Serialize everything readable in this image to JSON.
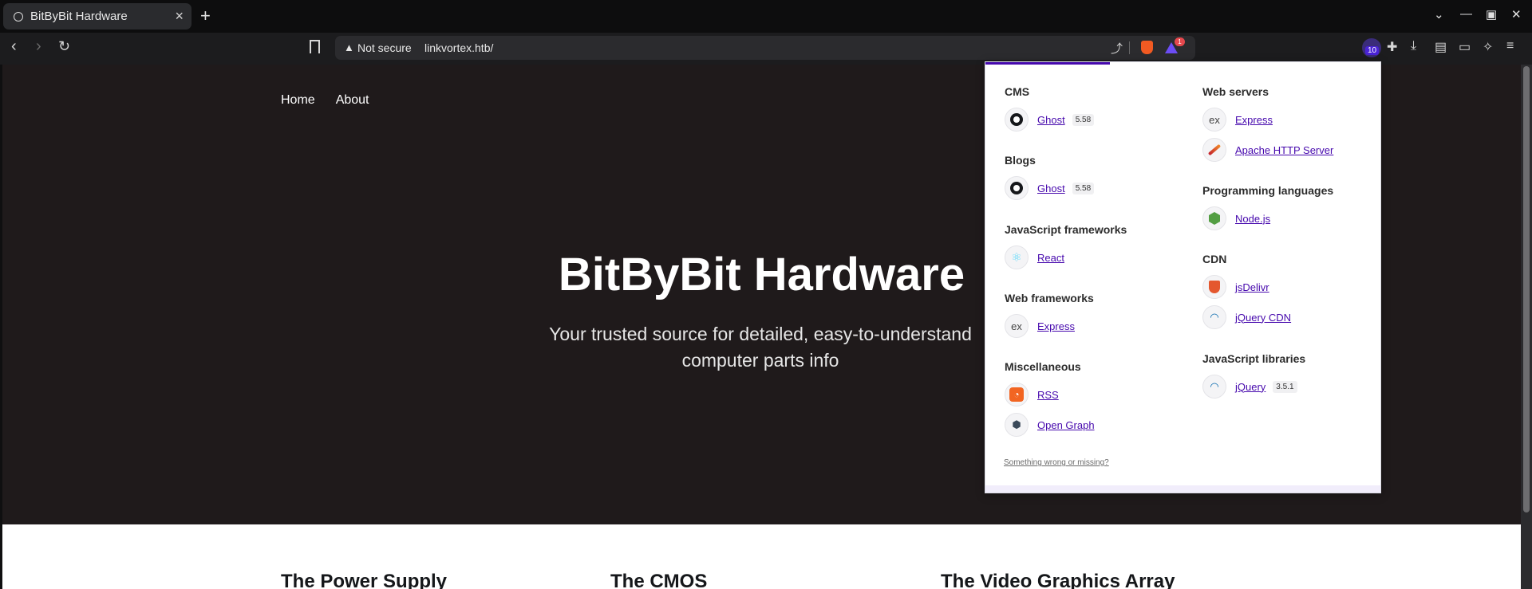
{
  "browser": {
    "tab_title": "BitByBit Hardware",
    "new_tab": "+",
    "address": {
      "security_label": "Not secure",
      "url": "linkvortex.htb/"
    },
    "extension_badge": "1",
    "wappalyzer_count": "10"
  },
  "page": {
    "nav": [
      "Home",
      "About"
    ],
    "hero_title": "BitByBit Hardware",
    "hero_description": "Your trusted source for detailed, easy-to-understand computer parts info",
    "cards": [
      "The Power Supply",
      "The CMOS",
      "The Video Graphics Array"
    ]
  },
  "wappalyzer": {
    "left_categories": [
      {
        "title": "CMS",
        "techs": [
          {
            "name": "Ghost",
            "version": "5.58",
            "icon": "ghost-icon"
          }
        ]
      },
      {
        "title": "Blogs",
        "techs": [
          {
            "name": "Ghost",
            "version": "5.58",
            "icon": "ghost-icon"
          }
        ]
      },
      {
        "title": "JavaScript frameworks",
        "techs": [
          {
            "name": "React",
            "version": "",
            "icon": "react-icon"
          }
        ]
      },
      {
        "title": "Web frameworks",
        "techs": [
          {
            "name": "Express",
            "version": "",
            "icon": "express-icon"
          }
        ]
      },
      {
        "title": "Miscellaneous",
        "techs": [
          {
            "name": "RSS",
            "version": "",
            "icon": "rss-icon"
          },
          {
            "name": "Open Graph",
            "version": "",
            "icon": "open-graph-icon"
          }
        ]
      }
    ],
    "right_categories": [
      {
        "title": "Web servers",
        "techs": [
          {
            "name": "Express",
            "version": "",
            "icon": "express-icon"
          },
          {
            "name": "Apache HTTP Server",
            "version": "",
            "icon": "apache-icon"
          }
        ]
      },
      {
        "title": "Programming languages",
        "techs": [
          {
            "name": "Node.js",
            "version": "",
            "icon": "nodejs-icon"
          }
        ]
      },
      {
        "title": "CDN",
        "techs": [
          {
            "name": "jsDelivr",
            "version": "",
            "icon": "jsdelivr-icon"
          },
          {
            "name": "jQuery CDN",
            "version": "",
            "icon": "jquery-icon"
          }
        ]
      },
      {
        "title": "JavaScript libraries",
        "techs": [
          {
            "name": "jQuery",
            "version": "3.5.1",
            "icon": "jquery-icon"
          }
        ]
      }
    ],
    "feedback_link": "Something wrong or missing?"
  },
  "colors": {
    "accent": "#4608ad",
    "hero_bg": "#1f1a1b"
  }
}
